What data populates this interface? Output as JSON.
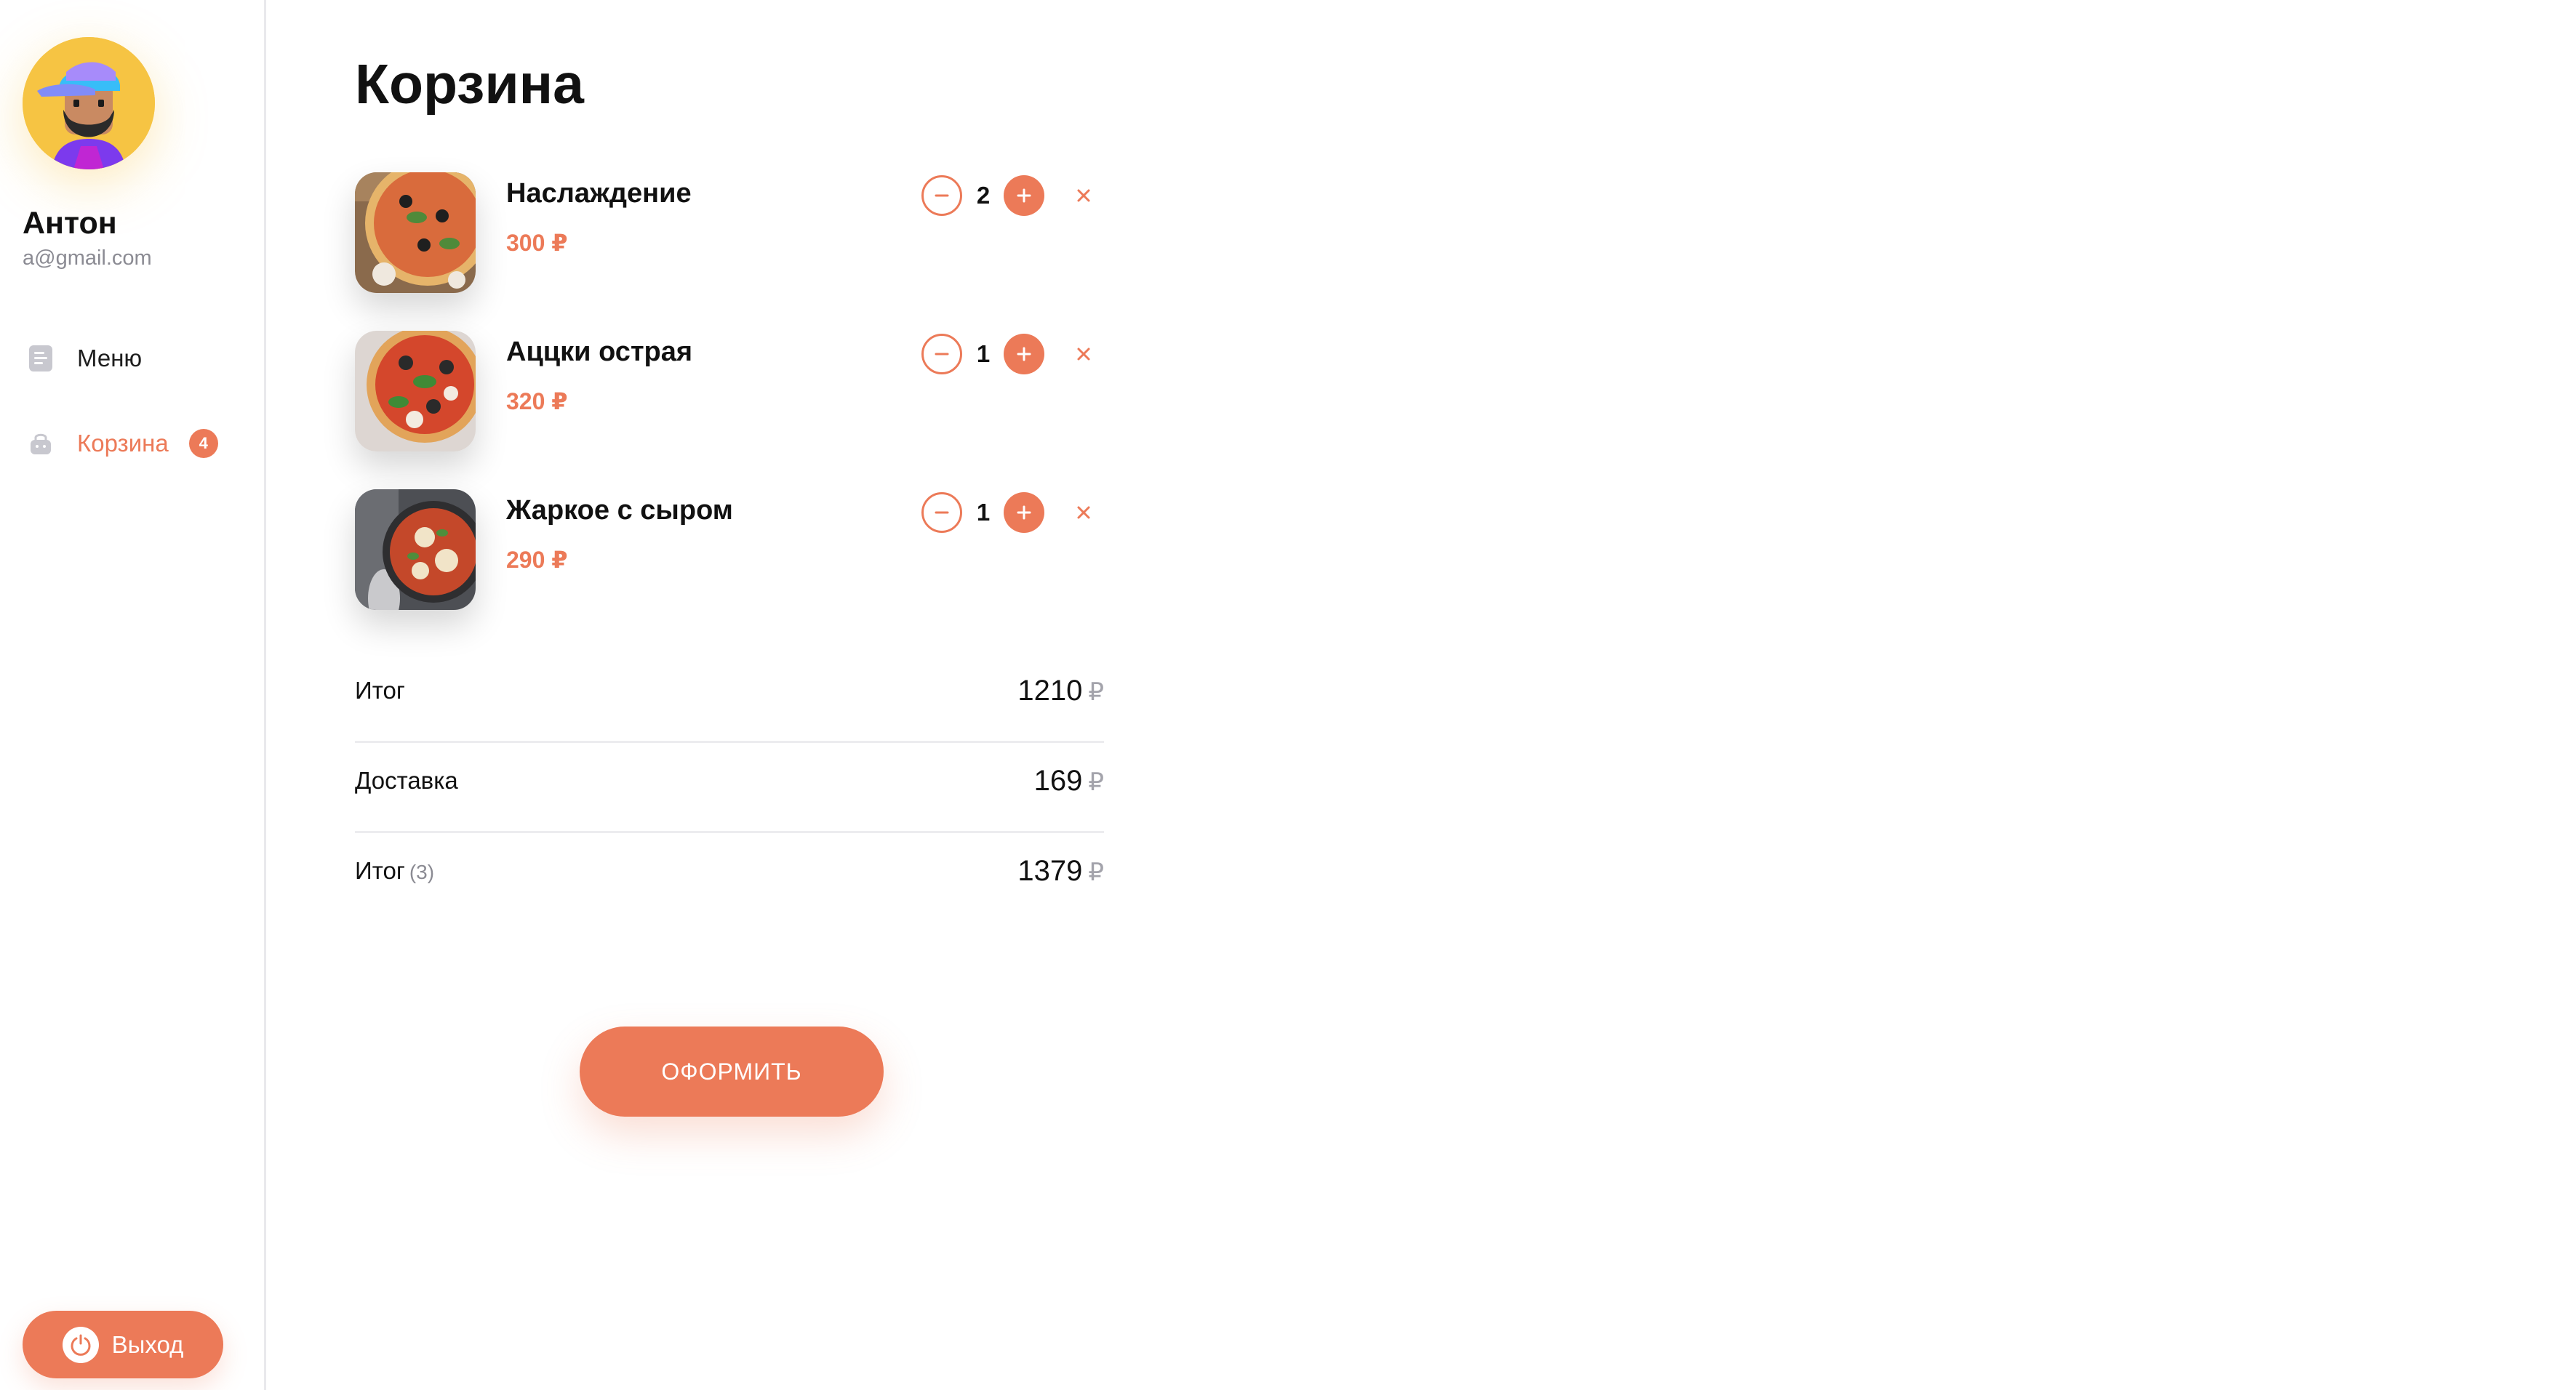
{
  "colors": {
    "accent": "#ec7a58",
    "avatar_bg": "#f6c443",
    "muted": "#8b8b93"
  },
  "user": {
    "name": "Антон",
    "email": "a@gmail.com",
    "avatar_icon": "bearded-man-avatar"
  },
  "nav": {
    "items": [
      {
        "label": "Меню",
        "icon": "document-icon",
        "active": false
      },
      {
        "label": "Корзина",
        "icon": "bag-icon",
        "active": true,
        "badge": "4"
      }
    ]
  },
  "logout": {
    "label": "Выход",
    "icon": "power-icon"
  },
  "page": {
    "title": "Корзина"
  },
  "cart": {
    "items": [
      {
        "name": "Наслаждение",
        "price": "300 ₽",
        "quantity": "2",
        "image": "pizza-olives-photo"
      },
      {
        "name": "Аццки острая",
        "price": "320 ₽",
        "quantity": "1",
        "image": "pizza-spicy-photo"
      },
      {
        "name": "Жаркое с сыром",
        "price": "290 ₽",
        "quantity": "1",
        "image": "roast-cheese-photo"
      }
    ]
  },
  "summary": {
    "subtotal": {
      "label": "Итог",
      "value": "1210",
      "currency": "₽"
    },
    "delivery": {
      "label": "Доставка",
      "value": "169",
      "currency": "₽"
    },
    "total": {
      "label": "Итог",
      "count": "(3)",
      "value": "1379",
      "currency": "₽"
    }
  },
  "checkout": {
    "label": "ОФОРМИТЬ"
  }
}
